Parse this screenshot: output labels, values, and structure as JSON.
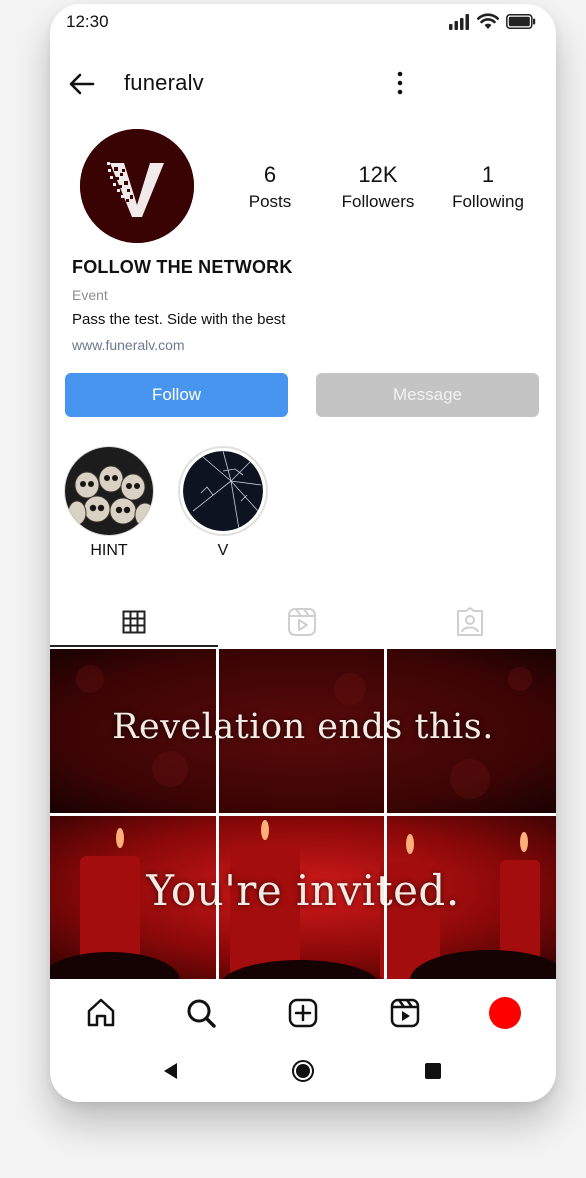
{
  "status_bar": {
    "time": "12:30",
    "icons": [
      "signal-icon",
      "wifi-icon",
      "battery-icon"
    ]
  },
  "header": {
    "username": "funeralv",
    "back_icon": "arrow-left-icon",
    "more_icon": "more-vertical-icon"
  },
  "profile": {
    "avatar_letter": "V",
    "avatar_color": "#3a0303",
    "stats": [
      {
        "value": "6",
        "label": "Posts"
      },
      {
        "value": "12K",
        "label": "Followers"
      },
      {
        "value": "1",
        "label": "Following"
      }
    ],
    "name": "FOLLOW THE NETWORK",
    "category": "Event",
    "bio": "Pass the test. Side with the best",
    "link": "www.funeralv.com"
  },
  "actions": {
    "follow_label": "Follow",
    "message_label": "Message",
    "follow_color": "#4795ee",
    "message_color": "#c4c4c4"
  },
  "highlights": [
    {
      "label": "HINT",
      "icon": "skulls-image"
    },
    {
      "label": "V",
      "icon": "cracked-glass-image"
    }
  ],
  "tabs": [
    {
      "name": "grid",
      "icon": "grid-icon",
      "active": true
    },
    {
      "name": "reels",
      "icon": "reels-icon",
      "active": false
    },
    {
      "name": "tagged",
      "icon": "tagged-icon",
      "active": false
    }
  ],
  "posts": {
    "row1_text": "Revelation ends this.",
    "row2_text": "You're invited."
  },
  "bottom_nav": [
    {
      "name": "home",
      "icon": "home-icon"
    },
    {
      "name": "search",
      "icon": "search-icon"
    },
    {
      "name": "create",
      "icon": "plus-square-icon"
    },
    {
      "name": "reels",
      "icon": "reels-icon"
    },
    {
      "name": "profile",
      "icon": "profile-dot-icon",
      "color": "#ff0000"
    }
  ],
  "system_nav": [
    "back-triangle-icon",
    "home-circle-icon",
    "recents-square-icon"
  ]
}
